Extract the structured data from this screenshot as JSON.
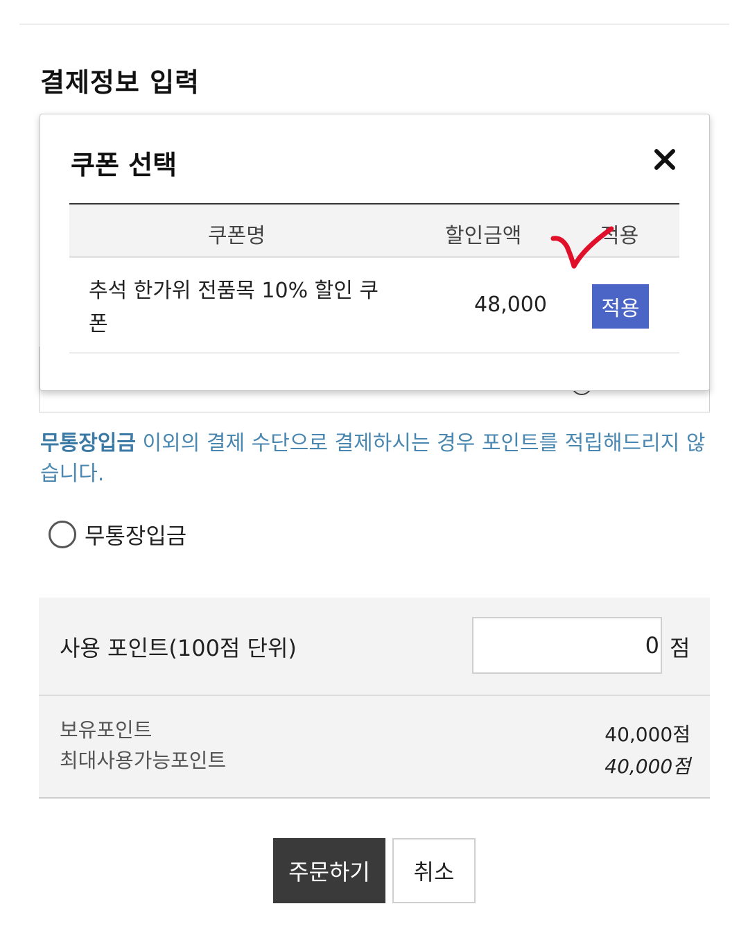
{
  "page": {
    "section_title": "결제정보 입력"
  },
  "notice": {
    "highlight": "무통장입금",
    "text": " 이외의 결제 수단으로 결제하시는 경우 포인트를 적립해드리지 않습니다."
  },
  "payment_method": {
    "option_label": "무통장입금"
  },
  "points": {
    "use_label": "사용 포인트(100점 단위)",
    "use_value": "0",
    "use_unit": "점",
    "own_label": "보유포인트",
    "own_value": "40,000점",
    "max_label": "최대사용가능포인트",
    "max_value": "40,000점"
  },
  "buttons": {
    "order": "주문하기",
    "cancel": "취소"
  },
  "modal": {
    "title": "쿠폰 선택",
    "columns": {
      "name": "쿠폰명",
      "amount": "할인금액",
      "apply": "적용"
    },
    "coupons": [
      {
        "name": "추석 한가위 전품목 10% 할인 쿠폰",
        "amount": "48,000",
        "apply_label": "적용"
      }
    ]
  },
  "colors": {
    "apply_button": "#4a65c6",
    "notice_text": "#4a87b0",
    "order_button": "#3a3a3a",
    "annotation_check": "#e0102a"
  },
  "icons": {
    "close": "close-icon",
    "annotation": "red-checkmark-icon"
  }
}
